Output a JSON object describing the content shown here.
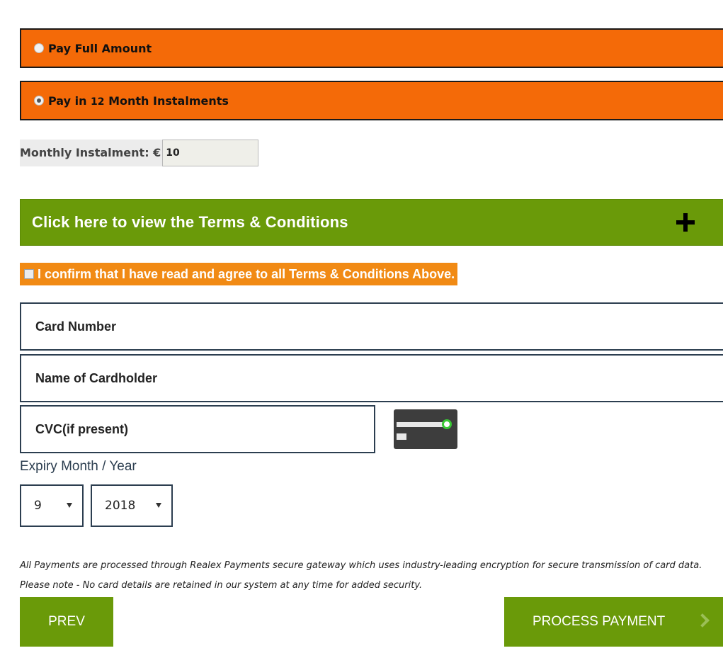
{
  "payment_options": {
    "full": {
      "label": "Pay Full Amount",
      "selected": false
    },
    "instalments": {
      "label_prefix": "Pay in ",
      "months": "12",
      "label_suffix": " Month Instalments",
      "selected": true
    }
  },
  "monthly": {
    "label": "Monthly Instalment: €",
    "value": "10"
  },
  "terms": {
    "label": "Click here to view the Terms & Conditions",
    "icon": "plus-icon"
  },
  "confirm": {
    "label": "I confirm that I have read and agree to all Terms & Conditions Above.",
    "checked": false
  },
  "card": {
    "number_placeholder": "Card Number",
    "holder_placeholder": "Name of Cardholder",
    "cvc_placeholder": "CVC(if present)",
    "cvc_icon": "card-cvc-icon"
  },
  "expiry": {
    "label": "Expiry Month / Year",
    "month": "9",
    "year": "2018"
  },
  "notice": "All Payments are processed through Realex Payments secure gateway which uses industry-leading encryption for secure transmission of card data. Please note - No card details are retained in our system at any time for added security.",
  "buttons": {
    "prev": "PREV",
    "process": "PROCESS PAYMENT"
  },
  "colors": {
    "orange": "#f46a08",
    "green": "#6a9a09",
    "confirm_orange": "#f18a14"
  }
}
